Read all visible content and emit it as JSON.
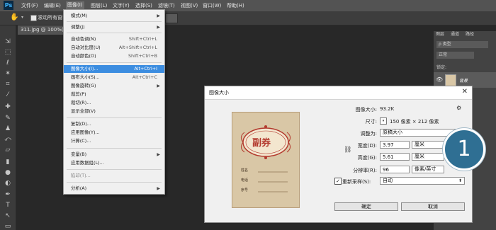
{
  "app": {
    "logo": "Ps",
    "menus": [
      "文件(F)",
      "编辑(E)",
      "图像(I)",
      "图层(L)",
      "文字(Y)",
      "选择(S)",
      "滤镜(T)",
      "视图(V)",
      "窗口(W)",
      "帮助(H)"
    ],
    "active_menu": "图像(I)"
  },
  "options_bar": {
    "checkbox_label": "滚动所有窗口"
  },
  "document_tab": {
    "title": "311.jpg @ 100%(R"
  },
  "right_panel": {
    "tabs": [
      "图层",
      "通道",
      "路径"
    ],
    "filter_label": "ρ 类型",
    "blend_label": "正常",
    "lock_label": "锁定:",
    "layer_label": "背景"
  },
  "image_menu": {
    "items": [
      {
        "label": "模式(M)",
        "shortcut": "",
        "submenu": true,
        "disabled": false
      },
      {
        "label": "调整(J)",
        "shortcut": "",
        "submenu": true,
        "disabled": false
      },
      {
        "label": "自动色调(N)",
        "shortcut": "Shift+Ctrl+L",
        "submenu": false,
        "disabled": false
      },
      {
        "label": "自动对比度(U)",
        "shortcut": "Alt+Shift+Ctrl+L",
        "submenu": false,
        "disabled": false
      },
      {
        "label": "自动颜色(O)",
        "shortcut": "Shift+Ctrl+B",
        "submenu": false,
        "disabled": false
      },
      {
        "label": "图像大小(I)...",
        "shortcut": "Alt+Ctrl+I",
        "submenu": false,
        "disabled": false
      },
      {
        "label": "画布大小(S)...",
        "shortcut": "Alt+Ctrl+C",
        "submenu": false,
        "disabled": false
      },
      {
        "label": "图像旋转(G)",
        "shortcut": "",
        "submenu": true,
        "disabled": false
      },
      {
        "label": "裁剪(P)",
        "shortcut": "",
        "submenu": false,
        "disabled": false
      },
      {
        "label": "裁切(R)...",
        "shortcut": "",
        "submenu": false,
        "disabled": false
      },
      {
        "label": "显示全部(V)",
        "shortcut": "",
        "submenu": false,
        "disabled": false
      },
      {
        "label": "复制(D)...",
        "shortcut": "",
        "submenu": false,
        "disabled": false
      },
      {
        "label": "应用图像(Y)...",
        "shortcut": "",
        "submenu": false,
        "disabled": false
      },
      {
        "label": "计算(C)...",
        "shortcut": "",
        "submenu": false,
        "disabled": false
      },
      {
        "label": "变量(B)",
        "shortcut": "",
        "submenu": true,
        "disabled": false
      },
      {
        "label": "应用数据组(L)...",
        "shortcut": "",
        "submenu": false,
        "disabled": false
      },
      {
        "label": "陷印(T)...",
        "shortcut": "",
        "submenu": false,
        "disabled": true
      },
      {
        "label": "分析(A)",
        "shortcut": "",
        "submenu": true,
        "disabled": false
      }
    ],
    "selected_index": 5
  },
  "dialog": {
    "title": "图像大小",
    "image_size_label": "图像大小:",
    "image_size_value": "93.2K",
    "dimensions_label": "尺寸:",
    "dimensions_value": "150 像素 × 212 像素",
    "fit_label": "调整为:",
    "fit_value": "原稿大小",
    "width_label": "宽度(D):",
    "width_value": "3.97",
    "width_unit": "厘米",
    "height_label": "高度(G):",
    "height_value": "5.61",
    "height_unit": "厘米",
    "resolution_label": "分辨率(R):",
    "resolution_value": "96",
    "resolution_unit": "像素/英寸",
    "resample_label": "重新采样(S):",
    "resample_value": "自动",
    "resample_checked": true,
    "ok_label": "确定",
    "cancel_label": "取消",
    "preview": {
      "title": "副券",
      "field1": "姓名",
      "field2": "电话",
      "field3": "序号"
    }
  },
  "step_badge": "1",
  "colors": {
    "app_bg": "#282828",
    "menu_highlight": "#3c8de0",
    "badge": "#2f6f93",
    "voucher_title": "#b33a2e"
  }
}
